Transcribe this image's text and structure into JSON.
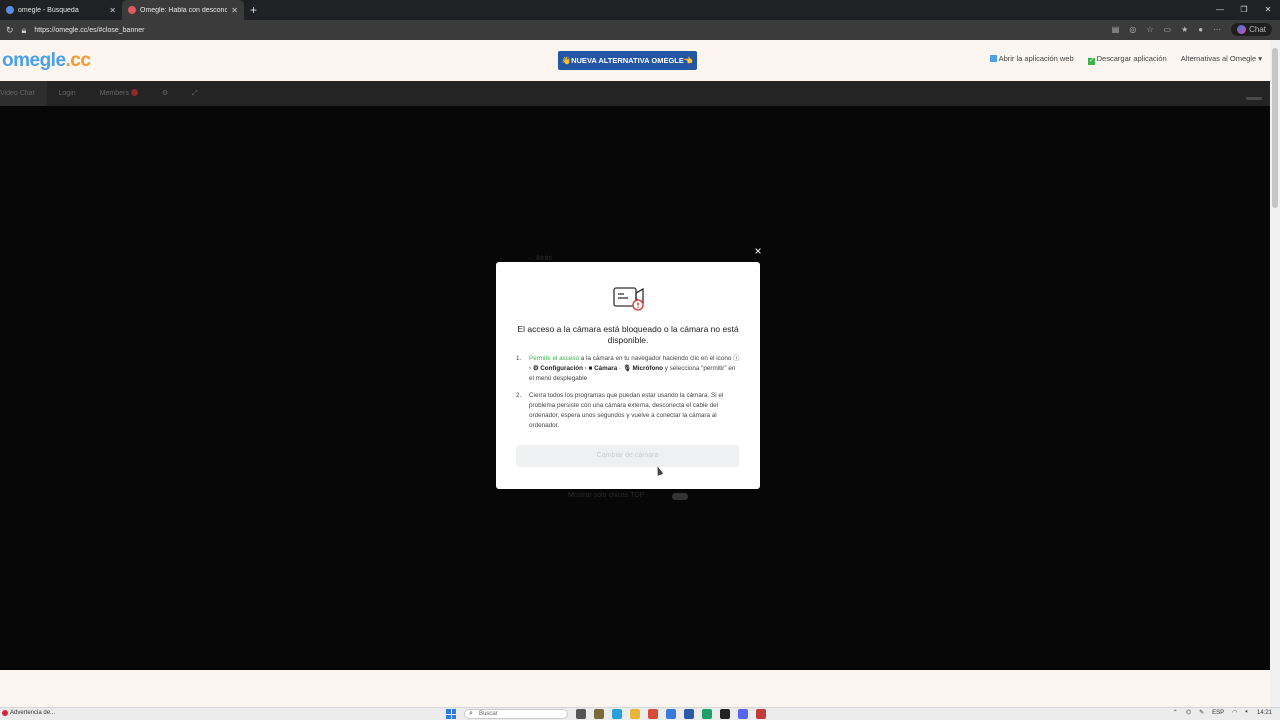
{
  "browser": {
    "tabs": [
      {
        "title": "omegle - Búsqueda",
        "active": false
      },
      {
        "title": "Omegle: Habla con desconoc",
        "active": true
      }
    ],
    "new_tab": "+",
    "url": "https://omegle.cc/es/#close_banner",
    "chat_button": "Chat"
  },
  "site": {
    "logo": "omegle",
    "logo_tld": ".cc",
    "promo_button": "👋NUEVA ALTERNATIVA OMEGLE👈",
    "links": {
      "open_web_app": "Abrir la aplicación web",
      "download_app": "Descargar aplicación",
      "alternatives": "Alternativas al Omegle ▾"
    },
    "subnav": {
      "video_chat": "Video Chat",
      "login": "Login",
      "members": "Members"
    }
  },
  "behind": {
    "back": "← Atrás",
    "top_only": "Mostrar solo chicas TOP"
  },
  "modal": {
    "close": "×",
    "title": "El acceso a la cámara está bloqueado o la cámara no está disponible.",
    "step1_num": "1.",
    "step1_green": "Permite el acceso",
    "step1_text_a": " a la cámara en tu navegador haciendo clic en el icono ",
    "step1_config": "⚙ Configuración",
    "step1_camera": "■ Cámara",
    "step1_mic": "🎙 Micrófono",
    "step1_text_b": " y selecciona \"permitir\" en el menú desplegable",
    "step2_num": "2.",
    "step2_text": "Cierra todos los programas que puedan estar usando la cámara. Si el problema persiste con una cámara externa, desconecta el cable del ordenador, espera unos segundos y vuelve a conectar la cámara al ordenador.",
    "button": "Cambiar de cámara"
  },
  "taskbar": {
    "warning": "Advertencia de...",
    "search_placeholder": "Buscar",
    "lang": "ESP",
    "time": "14:21"
  },
  "colors": {
    "accent_blue": "#2456a6",
    "logo_blue": "#4aa1e8",
    "logo_orange": "#f39b2c",
    "green": "#3cb44a",
    "alert_red": "#d23030"
  }
}
